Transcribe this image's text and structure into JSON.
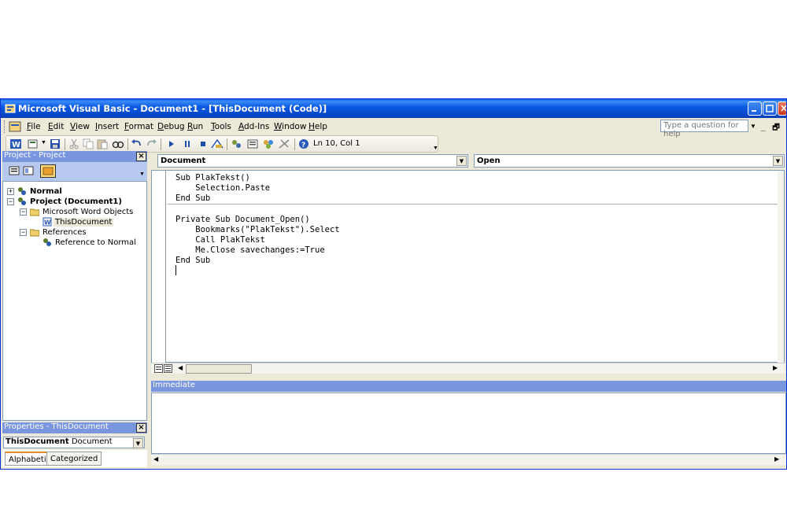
{
  "window": {
    "title": "Microsoft Visual Basic - Document1 - [ThisDocument (Code)]"
  },
  "menu": [
    "File",
    "Edit",
    "View",
    "Insert",
    "Format",
    "Debug",
    "Run",
    "Tools",
    "Add-Ins",
    "Window",
    "Help"
  ],
  "help_box": {
    "placeholder": "Type a question for help"
  },
  "toolbar": {
    "position": "Ln 10, Col 1"
  },
  "project_pane": {
    "title": "Project - Project",
    "tree": [
      {
        "label": "Normal",
        "bold": true
      },
      {
        "label": "Project (Document1)",
        "bold": true
      },
      {
        "label": "Microsoft Word Objects"
      },
      {
        "label": "ThisDocument",
        "selected": true
      },
      {
        "label": "References"
      },
      {
        "label": "Reference to Normal"
      }
    ]
  },
  "properties_pane": {
    "title": "Properties - ThisDocument",
    "object_name": "ThisDocument",
    "object_type": "Document",
    "tabs": [
      "Alphabetic",
      "Categorized"
    ]
  },
  "code_window": {
    "object_combo": "Document",
    "procedure_combo": "Open",
    "lines": [
      "Sub PlakTekst()",
      "    Selection.Paste",
      "End Sub",
      "",
      "Private Sub Document_Open()",
      "    Bookmarks(\"PlakTekst\").Select",
      "    Call PlakTekst",
      "    Me.Close savechanges:=True",
      "End Sub"
    ]
  },
  "immediate": {
    "title": "Immediate"
  }
}
